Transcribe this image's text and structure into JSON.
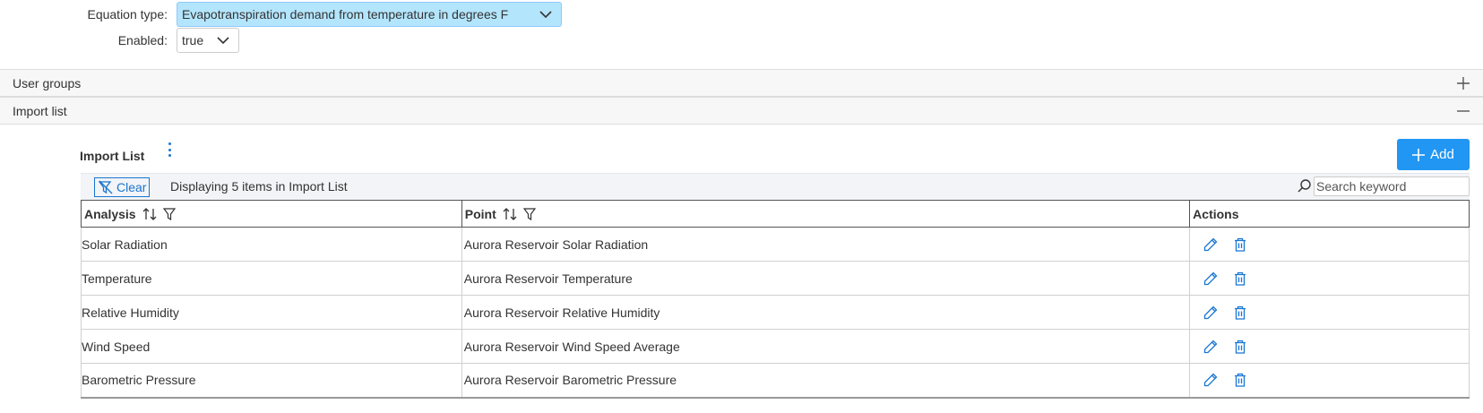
{
  "form": {
    "equation_label": "Equation type:",
    "equation_value": "Evapotranspiration demand from temperature in degrees F",
    "enabled_label": "Enabled:",
    "enabled_value": "true"
  },
  "accordion": {
    "user_groups": "User groups",
    "import_list": "Import list"
  },
  "grid": {
    "title": "Import List",
    "add_label": "Add",
    "clear_label": "Clear",
    "status": "Displaying 5 items in Import List",
    "search_placeholder": "Search keyword",
    "columns": [
      "Analysis",
      "Point",
      "Actions"
    ],
    "rows": [
      {
        "analysis": "Solar Radiation",
        "point": "Aurora Reservoir Solar Radiation"
      },
      {
        "analysis": "Temperature",
        "point": "Aurora Reservoir Temperature"
      },
      {
        "analysis": "Relative Humidity",
        "point": "Aurora Reservoir Relative Humidity"
      },
      {
        "analysis": "Wind Speed",
        "point": "Aurora Reservoir Wind Speed Average"
      },
      {
        "analysis": "Barometric Pressure",
        "point": "Aurora Reservoir Barometric Pressure"
      }
    ]
  },
  "colors": {
    "accent": "#2196f3",
    "select_bg": "#b3e5fc",
    "icon_blue": "#1976d2"
  }
}
